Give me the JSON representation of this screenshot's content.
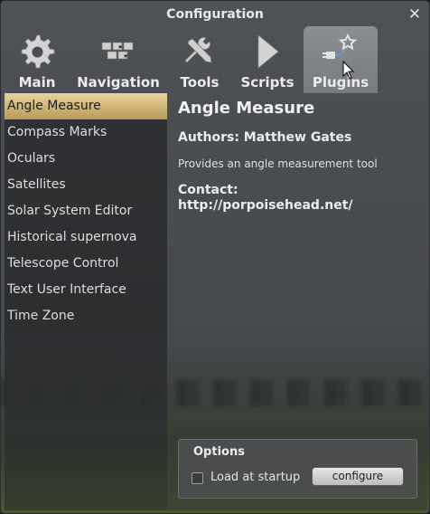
{
  "window": {
    "title": "Configuration"
  },
  "tabs": [
    {
      "label": "Main",
      "icon": "gear-icon"
    },
    {
      "label": "Navigation",
      "icon": "navigation-icon"
    },
    {
      "label": "Tools",
      "icon": "tools-icon"
    },
    {
      "label": "Scripts",
      "icon": "play-icon"
    },
    {
      "label": "Plugins",
      "icon": "plugin-icon",
      "active": true
    }
  ],
  "plugins": [
    "Angle Measure",
    "Compass Marks",
    "Oculars",
    "Satellites",
    "Solar System Editor",
    "Historical supernova",
    "Telescope Control",
    "Text User Interface",
    "Time Zone"
  ],
  "selected_plugin": {
    "title": "Angle Measure",
    "authors": "Authors: Matthew Gates",
    "description": "Provides an angle measurement tool",
    "contact_label": "Contact:",
    "contact": "http://porpoisehead.net/"
  },
  "options": {
    "title": "Options",
    "load_at_startup_label": "Load at startup",
    "load_at_startup_checked": false,
    "configure_label": "configure"
  },
  "colors": {
    "selection": "#d9c07e",
    "active_tab": "#8b8e93",
    "window_bg": "#4b4e53"
  }
}
